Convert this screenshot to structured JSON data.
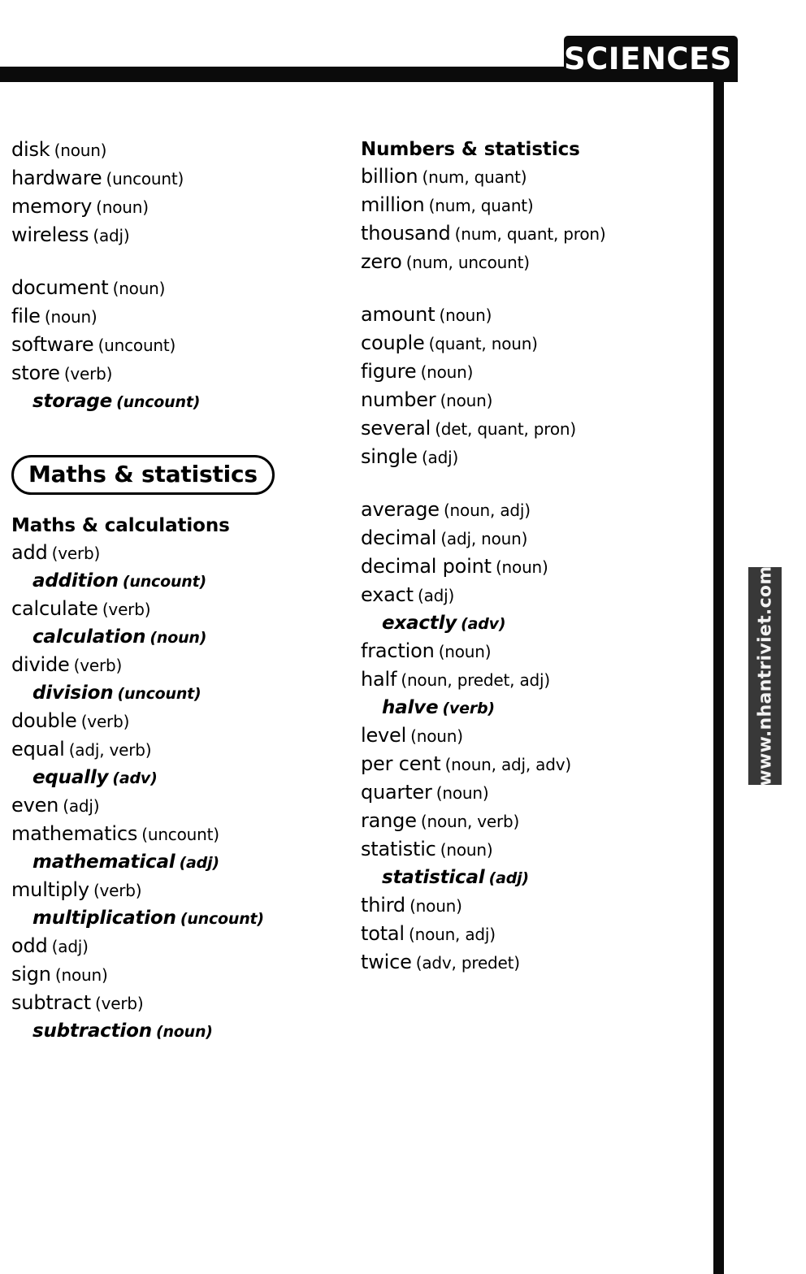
{
  "header": {
    "tab_label": "SCIENCES"
  },
  "watermark": {
    "text": "www.nhantriviet.com"
  },
  "left_column": {
    "groups": [
      {
        "heading": null,
        "entries": [
          {
            "word": "disk",
            "pos": "(noun)",
            "sub": false
          },
          {
            "word": "hardware",
            "pos": "(uncount)",
            "sub": false
          },
          {
            "word": "memory",
            "pos": "(noun)",
            "sub": false
          },
          {
            "word": "wireless",
            "pos": "(adj)",
            "sub": false
          }
        ]
      },
      {
        "heading": null,
        "entries": [
          {
            "word": "document",
            "pos": "(noun)",
            "sub": false
          },
          {
            "word": "file",
            "pos": "(noun)",
            "sub": false
          },
          {
            "word": "software",
            "pos": "(uncount)",
            "sub": false
          },
          {
            "word": "store",
            "pos": "(verb)",
            "sub": false
          },
          {
            "word": "storage",
            "pos": "(uncount)",
            "sub": true
          }
        ]
      }
    ],
    "section_title": "Maths & statistics",
    "subsection": {
      "heading": "Maths & calculations",
      "entries": [
        {
          "word": "add",
          "pos": "(verb)",
          "sub": false
        },
        {
          "word": "addition",
          "pos": "(uncount)",
          "sub": true
        },
        {
          "word": "calculate",
          "pos": "(verb)",
          "sub": false
        },
        {
          "word": "calculation",
          "pos": "(noun)",
          "sub": true
        },
        {
          "word": "divide",
          "pos": "(verb)",
          "sub": false
        },
        {
          "word": "division",
          "pos": "(uncount)",
          "sub": true
        },
        {
          "word": "double",
          "pos": "(verb)",
          "sub": false
        },
        {
          "word": "equal",
          "pos": "(adj, verb)",
          "sub": false
        },
        {
          "word": "equally",
          "pos": "(adv)",
          "sub": true
        },
        {
          "word": "even",
          "pos": "(adj)",
          "sub": false
        },
        {
          "word": "mathematics",
          "pos": "(uncount)",
          "sub": false
        },
        {
          "word": "mathematical",
          "pos": "(adj)",
          "sub": true
        },
        {
          "word": "multiply",
          "pos": "(verb)",
          "sub": false
        },
        {
          "word": "multiplication",
          "pos": "(uncount)",
          "sub": true
        },
        {
          "word": "odd",
          "pos": "(adj)",
          "sub": false
        },
        {
          "word": "sign",
          "pos": "(noun)",
          "sub": false
        },
        {
          "word": "subtract",
          "pos": "(verb)",
          "sub": false
        },
        {
          "word": "subtraction",
          "pos": "(noun)",
          "sub": true
        }
      ]
    }
  },
  "right_column": {
    "groups": [
      {
        "heading": "Numbers & statistics",
        "entries": [
          {
            "word": "billion",
            "pos": "(num, quant)",
            "sub": false
          },
          {
            "word": "million",
            "pos": "(num, quant)",
            "sub": false
          },
          {
            "word": "thousand",
            "pos": "(num, quant, pron)",
            "sub": false
          },
          {
            "word": "zero",
            "pos": "(num, uncount)",
            "sub": false
          }
        ]
      },
      {
        "heading": null,
        "entries": [
          {
            "word": "amount",
            "pos": "(noun)",
            "sub": false
          },
          {
            "word": "couple",
            "pos": "(quant, noun)",
            "sub": false
          },
          {
            "word": "figure",
            "pos": "(noun)",
            "sub": false
          },
          {
            "word": "number",
            "pos": "(noun)",
            "sub": false
          },
          {
            "word": "several",
            "pos": "(det, quant, pron)",
            "sub": false
          },
          {
            "word": "single",
            "pos": "(adj)",
            "sub": false
          }
        ]
      },
      {
        "heading": null,
        "entries": [
          {
            "word": "average",
            "pos": "(noun, adj)",
            "sub": false
          },
          {
            "word": "decimal",
            "pos": "(adj, noun)",
            "sub": false
          },
          {
            "word": "decimal point",
            "pos": "(noun)",
            "sub": false
          },
          {
            "word": "exact",
            "pos": "(adj)",
            "sub": false
          },
          {
            "word": "exactly",
            "pos": "(adv)",
            "sub": true
          },
          {
            "word": "fraction",
            "pos": "(noun)",
            "sub": false
          },
          {
            "word": "half",
            "pos": "(noun, predet, adj)",
            "sub": false
          },
          {
            "word": "halve",
            "pos": "(verb)",
            "sub": true
          },
          {
            "word": "level",
            "pos": "(noun)",
            "sub": false
          },
          {
            "word": "per cent",
            "pos": "(noun, adj, adv)",
            "sub": false
          },
          {
            "word": "quarter",
            "pos": "(noun)",
            "sub": false
          },
          {
            "word": "range",
            "pos": "(noun, verb)",
            "sub": false
          },
          {
            "word": "statistic",
            "pos": "(noun)",
            "sub": false
          },
          {
            "word": "statistical",
            "pos": "(adj)",
            "sub": true
          },
          {
            "word": "third",
            "pos": "(noun)",
            "sub": false
          },
          {
            "word": "total",
            "pos": "(noun, adj)",
            "sub": false
          },
          {
            "word": "twice",
            "pos": "(adv, predet)",
            "sub": false
          }
        ]
      }
    ]
  }
}
